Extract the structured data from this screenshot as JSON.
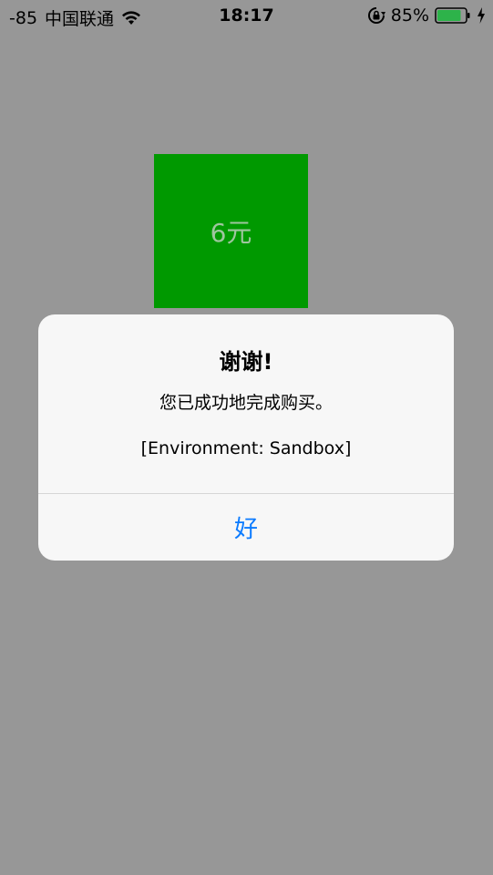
{
  "status_bar": {
    "signal": "-85",
    "carrier": "中国联通",
    "wifi_icon": "wifi-icon",
    "time": "18:17",
    "rotation_lock_icon": "rotation-lock-icon",
    "battery_percent": "85%",
    "battery_level": 0.85,
    "battery_color": "#2db34a",
    "charging_icon": "charging-bolt-icon"
  },
  "product": {
    "price_label": "6元",
    "tile_color": "#009900"
  },
  "alert": {
    "title": "谢谢!",
    "message": "您已成功地完成购买。",
    "environment": "[Environment: Sandbox]",
    "ok_button": "好",
    "button_color": "#0b7bff"
  }
}
